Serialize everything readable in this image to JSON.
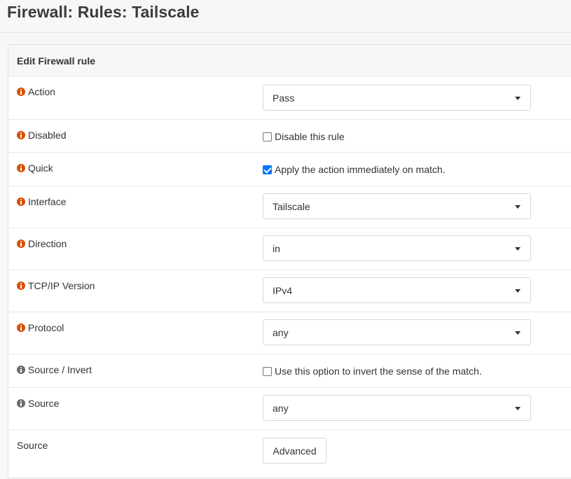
{
  "page": {
    "title": "Firewall: Rules: Tailscale"
  },
  "panel": {
    "heading": "Edit Firewall rule"
  },
  "rows": {
    "action": {
      "label": "Action",
      "value": "Pass",
      "icon": "info-icon",
      "icon_color": "#d94f00"
    },
    "disabled": {
      "label": "Disabled",
      "check_label": "Disable this rule",
      "checked": false,
      "icon": "info-icon",
      "icon_color": "#d94f00"
    },
    "quick": {
      "label": "Quick",
      "check_label": "Apply the action immediately on match.",
      "checked": true,
      "icon": "info-icon",
      "icon_color": "#d94f00"
    },
    "interface": {
      "label": "Interface",
      "value": "Tailscale",
      "icon": "info-icon",
      "icon_color": "#d94f00"
    },
    "direction": {
      "label": "Direction",
      "value": "in",
      "icon": "info-icon",
      "icon_color": "#d94f00"
    },
    "ipversion": {
      "label": "TCP/IP Version",
      "value": "IPv4",
      "icon": "info-icon",
      "icon_color": "#d94f00"
    },
    "protocol": {
      "label": "Protocol",
      "value": "any",
      "icon": "info-icon",
      "icon_color": "#d94f00"
    },
    "source_invert": {
      "label": "Source / Invert",
      "check_label": "Use this option to invert the sense of the match.",
      "checked": false,
      "icon": "info-icon",
      "icon_color": "#6b6b6b"
    },
    "source": {
      "label": "Source",
      "value": "any",
      "icon": "info-icon",
      "icon_color": "#6b6b6b"
    },
    "source_advanced": {
      "label": "Source",
      "button_label": "Advanced"
    }
  }
}
